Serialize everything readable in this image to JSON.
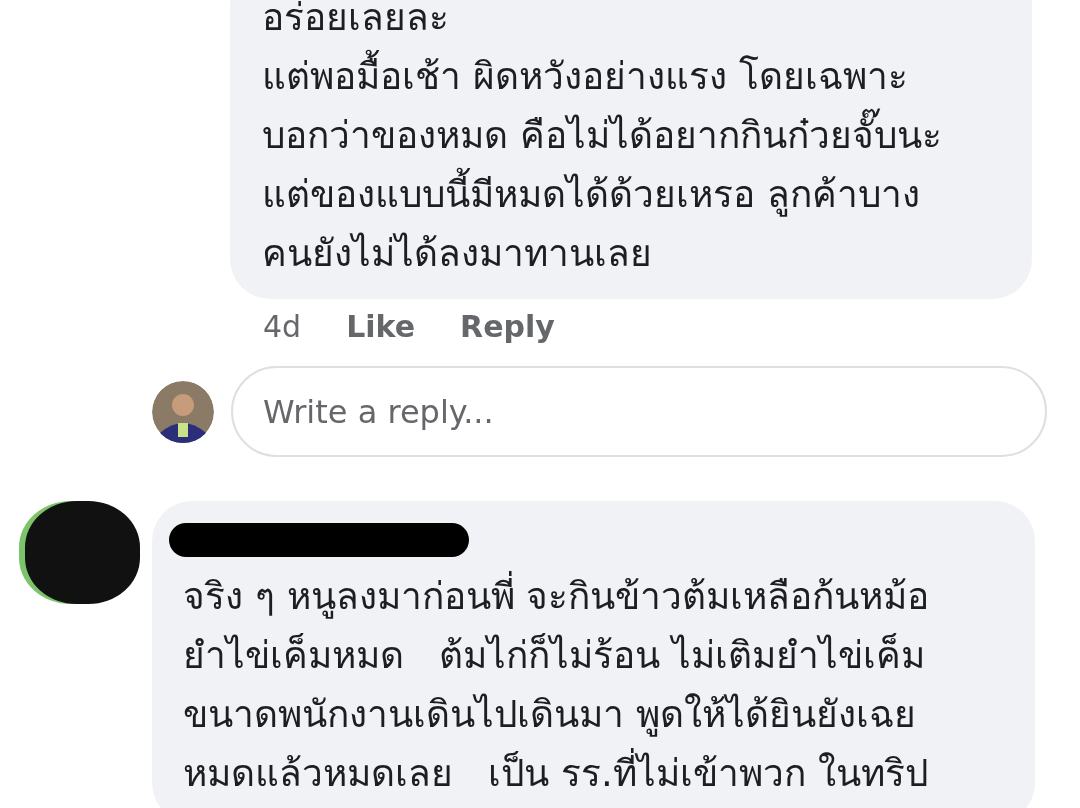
{
  "comments": [
    {
      "kind": "reply",
      "text": "อร่อยเลยละ\nแต่พอมื้อเช้า ผิดหวังอย่างแรง โดยเฉพาะ\nบอกว่าของหมด คือไม่ได้อยากกินก๋วยจั๊บนะ\nแต่ของแบบนี้มีหมดได้ด้วยเหรอ ลูกค้าบาง\nคนยังไม่ได้ลงมาทานเลย",
      "time": "4d",
      "actions": [
        "Like",
        "Reply"
      ]
    },
    {
      "kind": "composer",
      "placeholder": "Write a reply..."
    },
    {
      "kind": "comment",
      "author_redacted": true,
      "avatar_redacted": true,
      "text": "จริง ๆ หนูลงมาก่อนพี่ จะกินข้าวต้มเหลือก้นหม้อ\nยำไข่เค็มหมด   ต้มไก่ก็ไม่ร้อน ไม่เติมยำไข่เค็ม\nขนาดพนักงานเดินไปเดินมา พูดให้ได้ยินยังเฉย\nหมดแล้วหมดเลย   เป็น รร.ที่ไม่เข้าพวก ในทริป"
    }
  ]
}
